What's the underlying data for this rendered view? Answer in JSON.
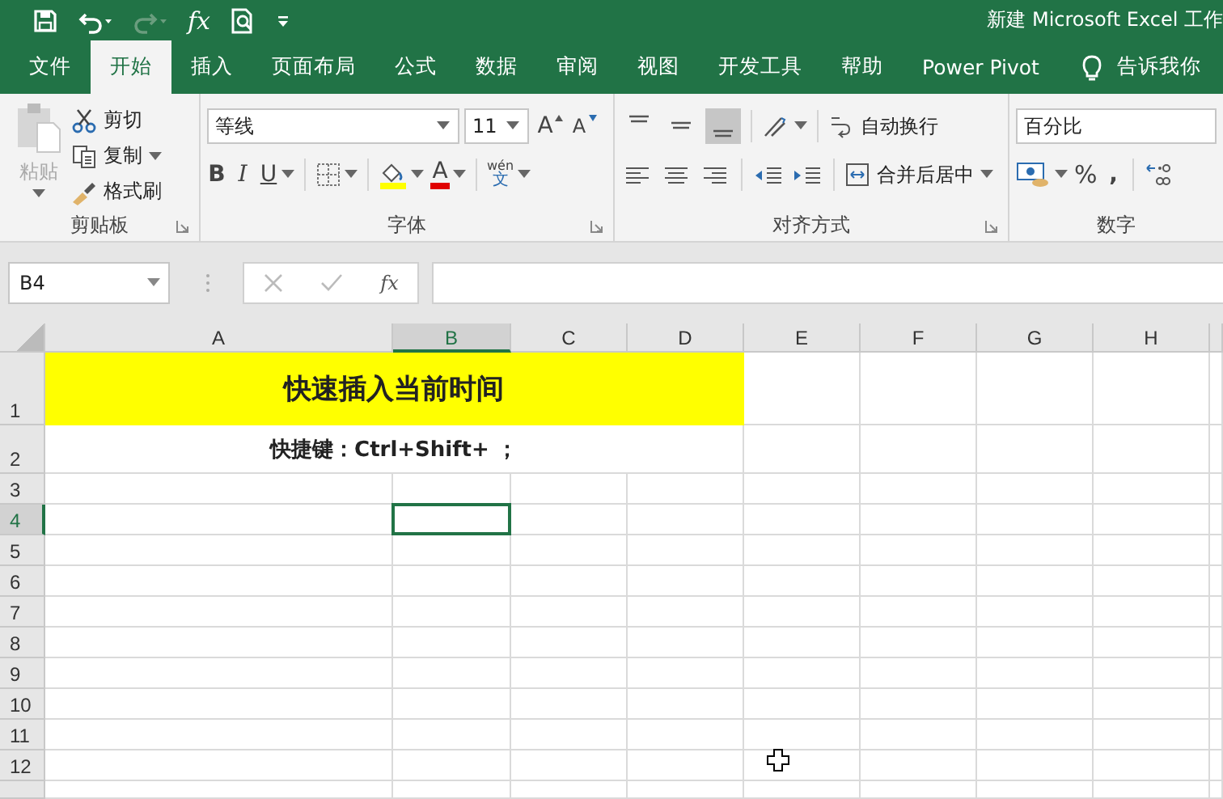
{
  "window": {
    "title": "新建 Microsoft Excel 工作",
    "qat_formula": "fx"
  },
  "tabs": [
    {
      "label": "文件",
      "selected": false
    },
    {
      "label": "开始",
      "selected": true
    },
    {
      "label": "插入",
      "selected": false
    },
    {
      "label": "页面布局",
      "selected": false
    },
    {
      "label": "公式",
      "selected": false
    },
    {
      "label": "数据",
      "selected": false
    },
    {
      "label": "审阅",
      "selected": false
    },
    {
      "label": "视图",
      "selected": false
    },
    {
      "label": "开发工具",
      "selected": false
    },
    {
      "label": "帮助",
      "selected": false
    },
    {
      "label": "Power Pivot",
      "selected": false
    }
  ],
  "tell_me": "告诉我你",
  "clipboard": {
    "label": "剪贴板",
    "paste": {
      "label": "粘贴",
      "disabled": true
    },
    "items": [
      "剪切",
      "复制",
      "格式刷"
    ]
  },
  "font": {
    "label": "字体",
    "font_name": "等线",
    "font_size": "11",
    "grow": "A",
    "shrink": "A",
    "bold": "B",
    "italic": "I",
    "underline": "U",
    "font_color": "A",
    "phonetic_top": "wén",
    "phonetic_bottom": "文"
  },
  "alignment": {
    "label": "对齐方式",
    "vertical_buttons": [
      {
        "selected": false
      },
      {
        "selected": false
      },
      {
        "selected": true
      }
    ],
    "wrap": "自动换行",
    "merge": "合并后居中"
  },
  "number": {
    "label": "数字",
    "format": "百分比",
    "percent": "%",
    "comma": ","
  },
  "formula_bar": {
    "name_box": "B4",
    "fx": "fx"
  },
  "sheet": {
    "columns": [
      {
        "label": "A",
        "selected": false
      },
      {
        "label": "B",
        "selected": true
      },
      {
        "label": "C",
        "selected": false
      },
      {
        "label": "D",
        "selected": false
      },
      {
        "label": "E",
        "selected": false
      },
      {
        "label": "F",
        "selected": false
      },
      {
        "label": "G",
        "selected": false
      },
      {
        "label": "H",
        "selected": false
      }
    ],
    "rows": [
      {
        "label": "1",
        "selected": false,
        "merged": {
          "kind": "title",
          "text": "快速插入当前时间"
        }
      },
      {
        "label": "2",
        "selected": false,
        "merged": {
          "kind": "note",
          "text": "快捷键：Ctrl+Shift+ ；"
        }
      },
      {
        "label": "3",
        "selected": false
      },
      {
        "label": "4",
        "selected": true
      },
      {
        "label": "5",
        "selected": false
      },
      {
        "label": "6",
        "selected": false
      },
      {
        "label": "7",
        "selected": false
      },
      {
        "label": "8",
        "selected": false
      },
      {
        "label": "9",
        "selected": false
      },
      {
        "label": "10",
        "selected": false
      },
      {
        "label": "11",
        "selected": false
      },
      {
        "label": "12",
        "selected": false
      }
    ]
  }
}
